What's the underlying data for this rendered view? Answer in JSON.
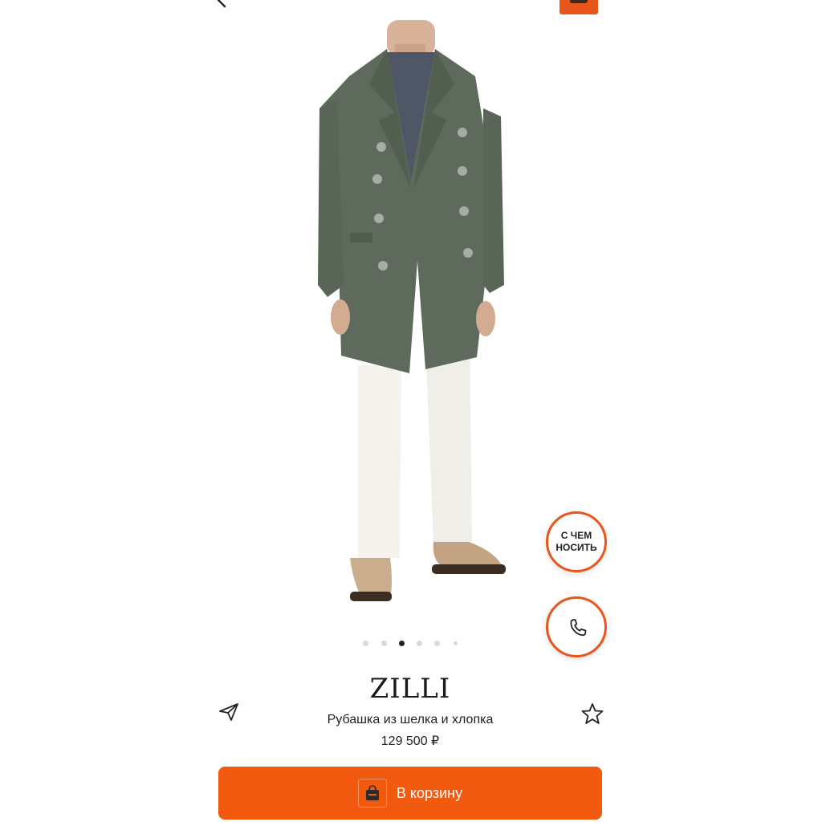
{
  "product": {
    "brand": "ZILLI",
    "title": "Рубашка из шелка и хлопка",
    "price": "129 500 ₽"
  },
  "gallery": {
    "image_count": 6,
    "active_index": 2
  },
  "actions": {
    "what_to_wear_label": "С ЧЕМ\nНОСИТЬ",
    "add_to_cart_label": "В корзину"
  },
  "icons": {
    "back": "chevron-left-icon",
    "cart": "shopping-bag-icon",
    "share": "paper-plane-icon",
    "favorite": "star-icon",
    "call": "phone-icon"
  },
  "colors": {
    "accent": "#f25a0f",
    "text": "#222222"
  }
}
